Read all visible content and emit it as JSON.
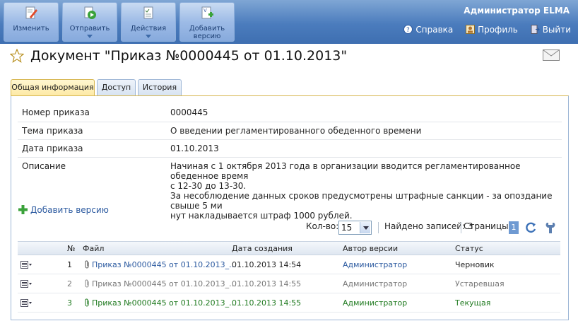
{
  "toolbar": {
    "buttons": [
      {
        "label": "Изменить"
      },
      {
        "label": "Отправить"
      },
      {
        "label": "Действия"
      },
      {
        "label": "Добавить версию",
        "label1": "Добавить",
        "label2": "версию"
      }
    ]
  },
  "header": {
    "user": "Администратор ELMA",
    "links": {
      "help": "Справка",
      "profile": "Профиль",
      "logout": "Выйти"
    }
  },
  "document": {
    "title": "Документ \"Приказ №0000445 от 01.10.2013\""
  },
  "tabs": [
    "Общая информация",
    "Доступ",
    "История"
  ],
  "fields": [
    {
      "label": "Номер приказа",
      "value": "0000445"
    },
    {
      "label": "Тема приказа",
      "value": "О введении регламентированного обеденного времени"
    },
    {
      "label": "Дата приказа",
      "value": "01.10.2013"
    },
    {
      "label": "Описание",
      "lines": [
        "Начиная с 1 октября 2013 года в организации вводится регламентированное обеденное время",
        "с 12-30 до 13-30.",
        "За несоблюдение данных сроков предусмотрены штрафные санкции - за опоздание свыше 5 ми",
        "нут накладывается штраф 1000 рублей."
      ]
    }
  ],
  "add_version": "Добавить версию",
  "paging": {
    "count_label": "Кол-во:",
    "count_value": "15",
    "found": "Найдено записей: 3",
    "pages_label": "Страницы:",
    "page": "1"
  },
  "table": {
    "headers": [
      "№",
      "Файл",
      "Дата создания",
      "Автор версии",
      "Статус"
    ],
    "rows": [
      {
        "num": "1",
        "file": "Приказ №0000445 от 01.10.2013_...",
        "date": "01.10.2013 14:54",
        "author": "Администратор",
        "status": "Черновик"
      },
      {
        "num": "2",
        "file": "Приказ №0000445 от 01.10.2013_...",
        "date": "01.10.2013 14:55",
        "author": "Администратор",
        "status": "Устаревшая"
      },
      {
        "num": "3",
        "file": "Приказ №0000445 от 01.10.2013_...",
        "date": "01.10.2013 14:55",
        "author": "Администратор",
        "status": "Текущая"
      }
    ]
  },
  "colors": {
    "link": "#2c5aa0",
    "current": "#1f7a1f",
    "obsolete": "#777777"
  }
}
